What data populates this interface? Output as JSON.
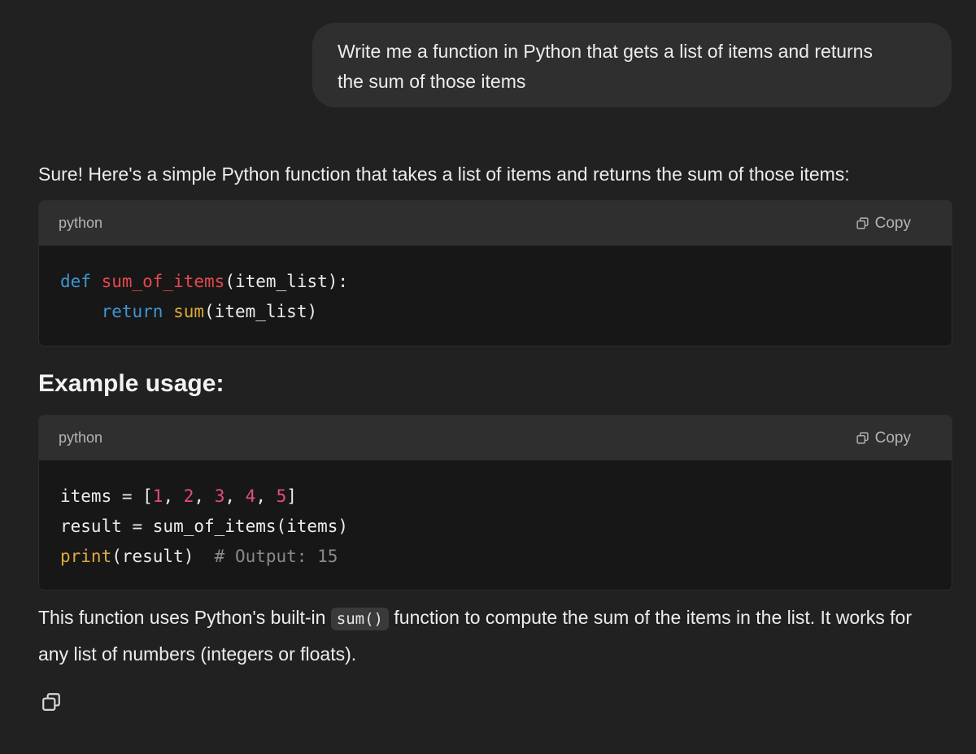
{
  "user_message": {
    "line1": "Write me a function in Python that gets a list of items and returns",
    "line2": "the sum of those items"
  },
  "assistant": {
    "intro": "Sure! Here's a simple Python function that takes a list of items and returns the sum of those items:",
    "heading": "Example usage:",
    "explain_before": "This function uses Python's built-in ",
    "explain_code": "sum()",
    "explain_after": " function to compute the sum of the items in the list. It works for any list of numbers (integers or floats)."
  },
  "code_blocks": [
    {
      "language": "python",
      "copy_label": "Copy",
      "line1": {
        "kw": "def",
        "fn": "sum_of_items",
        "rest": "(item_list):"
      },
      "line2": {
        "indent": "    ",
        "kw": "return",
        "bi": "sum",
        "rest": "(item_list)"
      }
    },
    {
      "language": "python",
      "copy_label": "Copy",
      "line1": {
        "a": "items = [",
        "n1": "1",
        "s1": ", ",
        "n2": "2",
        "s2": ", ",
        "n3": "3",
        "s3": ", ",
        "n4": "4",
        "s4": ", ",
        "n5": "5",
        "b": "]"
      },
      "line2": "result = sum_of_items(items)",
      "line3": {
        "bi": "print",
        "rest": "(result)  ",
        "comment": "# Output: 15"
      }
    }
  ],
  "icons": {
    "copy": "copy-icon"
  },
  "colors": {
    "background": "#212121",
    "bubble": "#2f2f2f",
    "code_bg": "#171717",
    "keyword": "#3f96d1",
    "function_name": "#e5484d",
    "builtin": "#e0a93b",
    "number": "#e24f7a",
    "comment": "#8a8a8a"
  }
}
